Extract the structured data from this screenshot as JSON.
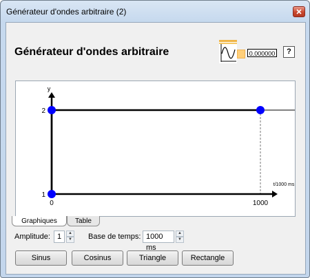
{
  "window": {
    "title": "Générateur d'ondes arbitraire (2)",
    "heading": "Générateur d'ondes arbitraire",
    "output_value": "0.000000",
    "help_label": "?"
  },
  "chart_data": {
    "type": "line",
    "title": "",
    "xlabel": "t/1000 ms",
    "ylabel": "y",
    "x_ticks": [
      "0",
      "1000"
    ],
    "y_ticks": [
      "1",
      "2"
    ],
    "xlim": [
      0,
      1000
    ],
    "ylim": [
      1,
      2
    ],
    "series": [
      {
        "x": [
          0,
          0,
          1000
        ],
        "y": [
          1,
          2,
          2
        ]
      }
    ],
    "control_points": [
      {
        "x": 0,
        "y": 1
      },
      {
        "x": 0,
        "y": 2
      },
      {
        "x": 1000,
        "y": 2
      }
    ],
    "colors": {
      "point": "#0000ff",
      "line": "#000000"
    }
  },
  "tabs": [
    {
      "label": "Graphiques",
      "active": true
    },
    {
      "label": "Table",
      "active": false
    }
  ],
  "fields": {
    "amplitude_label": "Amplitude:",
    "amplitude_value": "1",
    "timebase_label": "Base de temps:",
    "timebase_value": "1000 ms"
  },
  "buttons": {
    "sinus": "Sinus",
    "cosinus": "Cosinus",
    "triangle": "Triangle",
    "rectangle": "Rectangle"
  }
}
